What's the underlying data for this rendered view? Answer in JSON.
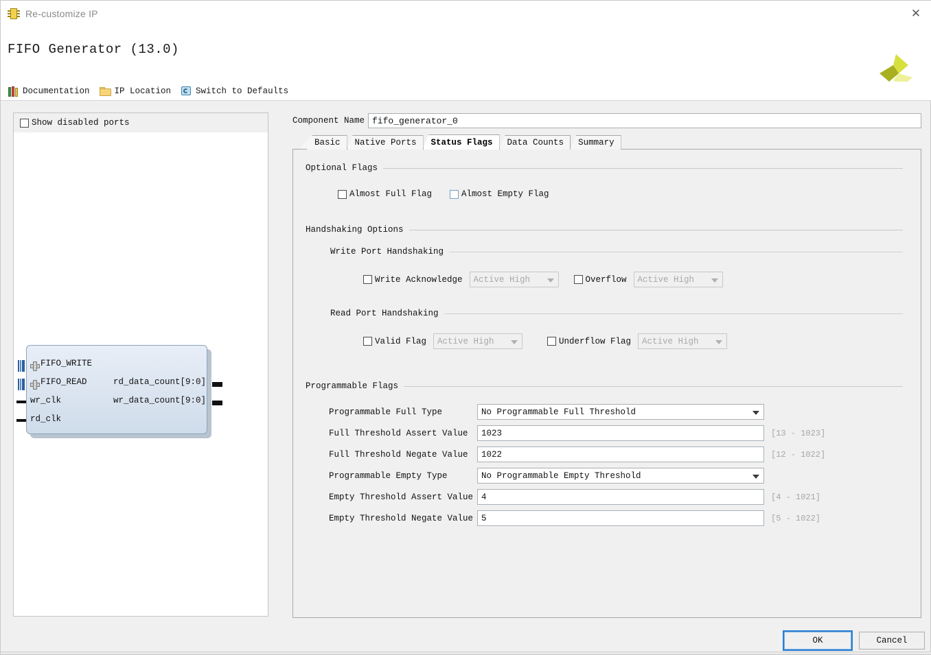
{
  "window": {
    "title": "Re-customize IP",
    "close_label": "✕",
    "app_title": "FIFO Generator (13.0)",
    "logo": "xilinx-logo"
  },
  "toolbar": {
    "items": [
      {
        "label": "Documentation",
        "icon": "books-icon"
      },
      {
        "label": "IP Location",
        "icon": "folder-icon"
      },
      {
        "label": "Switch to Defaults",
        "icon": "refresh-icon"
      }
    ]
  },
  "left_panel": {
    "show_disabled_ports": {
      "label": "Show disabled ports",
      "checked": false
    },
    "diagram": {
      "inputs": [
        {
          "name": "FIFO_WRITE",
          "type": "bus"
        },
        {
          "name": "FIFO_READ",
          "type": "bus"
        },
        {
          "name": "wr_clk",
          "type": "clk"
        },
        {
          "name": "rd_clk",
          "type": "clk"
        }
      ],
      "outputs": [
        {
          "name": "rd_data_count[9:0]"
        },
        {
          "name": "wr_data_count[9:0]"
        }
      ]
    }
  },
  "component": {
    "label": "Component Name",
    "value": "fifo_generator_0"
  },
  "tabs": [
    {
      "label": "Basic",
      "active": false
    },
    {
      "label": "Native Ports",
      "active": false
    },
    {
      "label": "Status Flags",
      "active": true
    },
    {
      "label": "Data Counts",
      "active": false
    },
    {
      "label": "Summary",
      "active": false
    }
  ],
  "sections": {
    "optional_flags": {
      "title": "Optional Flags",
      "checkboxes": [
        {
          "label": "Almost Full Flag",
          "checked": false
        },
        {
          "label": "Almost Empty Flag",
          "checked": false
        }
      ]
    },
    "handshaking": {
      "title": "Handshaking Options",
      "write_port": {
        "title": "Write Port Handshaking",
        "rows": [
          {
            "label": "Write Acknowledge",
            "checked": false,
            "polarity": "Active High",
            "enabled": false
          },
          {
            "label": "Overflow",
            "checked": false,
            "polarity": "Active High",
            "enabled": false
          }
        ]
      },
      "read_port": {
        "title": "Read Port Handshaking",
        "rows": [
          {
            "label": "Valid Flag",
            "checked": false,
            "polarity": "Active High",
            "enabled": false
          },
          {
            "label": "Underflow Flag",
            "checked": false,
            "polarity": "Active High",
            "enabled": false
          }
        ]
      }
    },
    "programmable_flags": {
      "title": "Programmable Flags",
      "full_type": {
        "label": "Programmable Full Type",
        "value": "No Programmable Full Threshold"
      },
      "full_assert": {
        "label": "Full Threshold Assert Value",
        "value": "1023",
        "range": "[13 - 1023]"
      },
      "full_negate": {
        "label": "Full Threshold Negate Value",
        "value": "1022",
        "range": "[12 - 1022]"
      },
      "empty_type": {
        "label": "Programmable Empty Type",
        "value": "No Programmable Empty Threshold"
      },
      "empty_assert": {
        "label": "Empty Threshold Assert Value",
        "value": "4",
        "range": "[4 - 1021]"
      },
      "empty_negate": {
        "label": "Empty Threshold Negate Value",
        "value": "5",
        "range": "[5 - 1022]"
      }
    }
  },
  "footer": {
    "ok": "OK",
    "cancel": "Cancel"
  }
}
